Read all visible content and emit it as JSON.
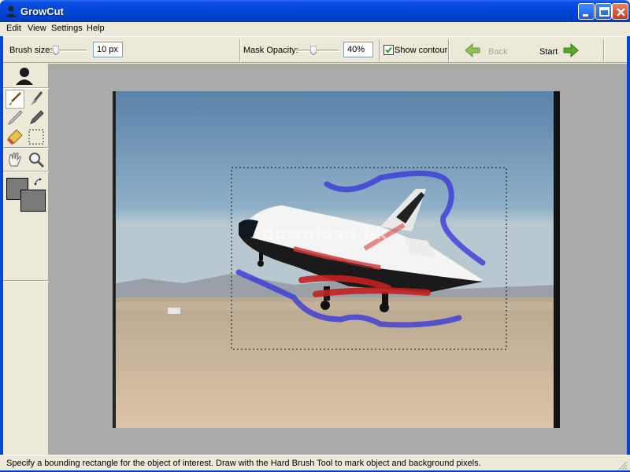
{
  "window": {
    "title": "GrowCut"
  },
  "menu": [
    "Edit",
    "View",
    "Settings",
    "Help"
  ],
  "toolbar": {
    "brush_size_label": "Brush size:",
    "brush_size_value": "10 px",
    "mask_opacity_label": "Mask Opacity:",
    "mask_opacity_value": "40%",
    "show_contour_label": "Show contour",
    "show_contour_checked": true,
    "back_label": "Back",
    "start_label": "Start"
  },
  "tools": [
    "user-icon",
    "hard-brush-icon",
    "soft-brush-icon",
    "pencil-icon",
    "marker-icon",
    "eraser-icon",
    "rectangle-select-icon",
    "hand-icon",
    "zoom-icon",
    "swap-colors-icon"
  ],
  "colors": {
    "foreground": "#7a7a7a",
    "background": "#7a7a7a",
    "object_stroke": "#cc2222",
    "background_stroke": "#3a3ad8"
  },
  "watermark": "download.hk",
  "status": {
    "text": "Specify a bounding rectangle for the object of interest. Draw with the Hard Brush Tool to mark object and background pixels."
  }
}
